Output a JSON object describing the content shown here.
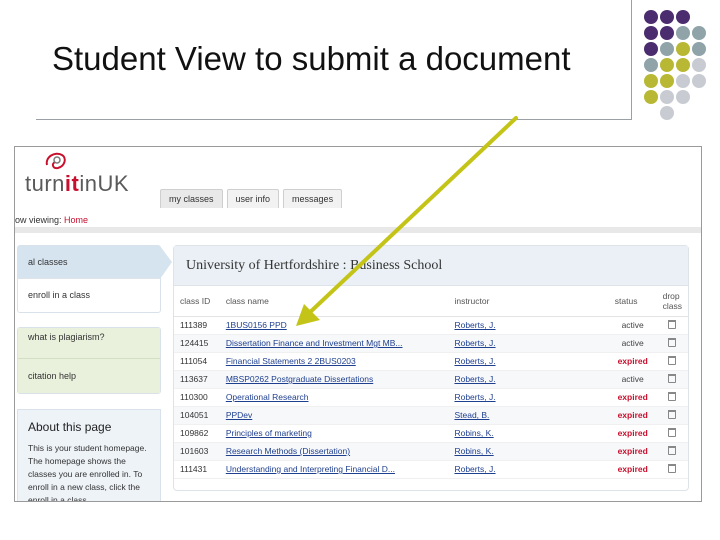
{
  "slide": {
    "title": "Student View to submit a document"
  },
  "app": {
    "logo_prefix": "turn",
    "logo_it": "it",
    "logo_suffix": "inUK"
  },
  "tabs": [
    {
      "label": "my classes"
    },
    {
      "label": "user info"
    },
    {
      "label": "messages"
    }
  ],
  "viewing": {
    "prefix": "ow viewing: ",
    "page": "Home"
  },
  "sidebar": {
    "items": [
      {
        "label": "al classes"
      },
      {
        "label": "enroll in a class"
      }
    ],
    "help_items": [
      {
        "label": "what is plagiarism?"
      },
      {
        "label": "citation help"
      }
    ],
    "about": {
      "title": "About this page",
      "text": "This is your student homepage. The homepage shows the classes you are enrolled in. To enroll in a new class, click the enroll in a class"
    }
  },
  "main": {
    "school": "University of Hertfordshire : Business School",
    "columns": {
      "id": "class ID",
      "name": "class name",
      "instructor": "instructor",
      "status": "status",
      "drop": "drop class"
    },
    "rows": [
      {
        "id": "111389",
        "name": "1BUS0156 PPD",
        "instructor": "Roberts, J.",
        "status": "active"
      },
      {
        "id": "124415",
        "name": "Dissertation Finance and Investment Mgt MB...",
        "instructor": "Roberts, J.",
        "status": "active"
      },
      {
        "id": "111054",
        "name": "Financial Statements 2 2BUS0203",
        "instructor": "Roberts, J.",
        "status": "expired"
      },
      {
        "id": "113637",
        "name": "MBSP0262 Postgraduate Dissertations",
        "instructor": "Roberts, J.",
        "status": "active"
      },
      {
        "id": "110300",
        "name": "Operational Research",
        "instructor": "Roberts, J.",
        "status": "expired"
      },
      {
        "id": "104051",
        "name": "PPDev",
        "instructor": "Stead, B.",
        "status": "expired"
      },
      {
        "id": "109862",
        "name": "Principles of marketing",
        "instructor": "Robins, K.",
        "status": "expired"
      },
      {
        "id": "101603",
        "name": "Research Methods (Dissertation)",
        "instructor": "Robins, K.",
        "status": "expired"
      },
      {
        "id": "111431",
        "name": "Understanding and Interpreting Financial D...",
        "instructor": "Roberts, J.",
        "status": "expired"
      }
    ]
  },
  "colors": {
    "dot_purple": "#4b2c6e",
    "dot_teal": "#8fa3a8",
    "dot_olive": "#b8b834",
    "dot_grey": "#c9cbd3",
    "arrow": "#c4c418",
    "brand_red": "#c8102e"
  }
}
